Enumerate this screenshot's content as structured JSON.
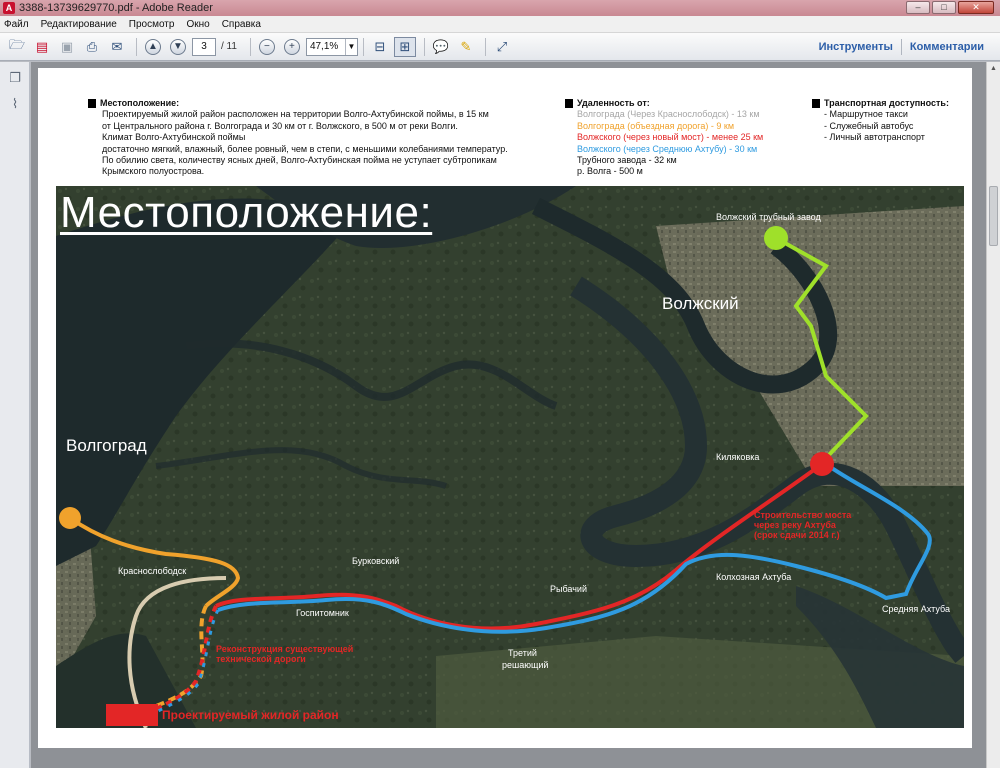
{
  "window": {
    "title": "3388-13739629770.pdf - Adobe Reader",
    "minimize": "–",
    "maximize": "□",
    "close": "✕"
  },
  "menu": {
    "items": [
      "Файл",
      "Редактирование",
      "Просмотр",
      "Окно",
      "Справка"
    ]
  },
  "toolbar": {
    "page_current": "3",
    "page_total": "/ 11",
    "zoom": "47,1%",
    "tools_label": "Инструменты",
    "comments_label": "Комментарии"
  },
  "document": {
    "location": {
      "heading": "Местоположение:",
      "lines": [
        "Проектируемый жилой район расположен на территории Волго-Ахтубинской поймы, в 15 км",
        "от Центрального района г. Волгограда и 30 км от г. Волжского, в 500 м от реки Волги.",
        "Климат Волго-Ахтубинской поймы",
        "достаточно мягкий, влажный, более ровный, чем в степи, с меньшими колебаниями температур.",
        "По обилию света, количеству ясных дней, Волго-Ахтубинская пойма не уступает субтропикам",
        "Крымского полуострова."
      ]
    },
    "distance": {
      "heading": "Удаленность от:",
      "items": [
        {
          "text": "Волгограда (Через Краснослободск) - 13 км",
          "color": "#a6a6a6"
        },
        {
          "text": "Волгограда (объездная дорога) - 9 км",
          "color": "#f0a22c"
        },
        {
          "text": "Волжского (через новый мост) - менее 25 км",
          "color": "#e32626"
        },
        {
          "text": "Волжского (через Среднюю Ахтубу) -   30 км",
          "color": "#2f9be0"
        },
        {
          "text": "Трубного завода - 32 км",
          "color": "#111111"
        },
        {
          "text": "р. Волга - 500 м",
          "color": "#111111"
        }
      ]
    },
    "transport": {
      "heading": "Транспортная доступность:",
      "items": [
        "- Маршрутное такси",
        "- Служебный автобус",
        "- Личный автотранспорт"
      ]
    },
    "map": {
      "title": "Местоположение:",
      "labels": {
        "volgograd": "Волгоград",
        "volzhsky": "Волжский",
        "pipe_plant": "Волжский трубный завод",
        "kilyakovka": "Киляковка",
        "krasnoslobodsk": "Краснослободск",
        "burkovsky": "Бурковский",
        "gospitomnik": "Госпитомник",
        "rybachiy": "Рыбачий",
        "tretiy": "Третий",
        "reshayushchiy": "решающий",
        "kolkhoznaya": "Колхозная Ахтуба",
        "srednyaya": "Средняя Ахтуба",
        "bridge_note": [
          "Строительство моста",
          "через реку Ахтуба",
          "(срок сдачи 2014 г.)"
        ],
        "road_note": [
          "Реконструкция существующей",
          "технической дороги"
        ],
        "district": "Проектируемый жилой район"
      },
      "route_colors": {
        "green": "#9fe02a",
        "orange": "#f0a22c",
        "gray": "#d8ccb0",
        "red": "#e32626",
        "blue": "#2f9be0"
      }
    }
  }
}
